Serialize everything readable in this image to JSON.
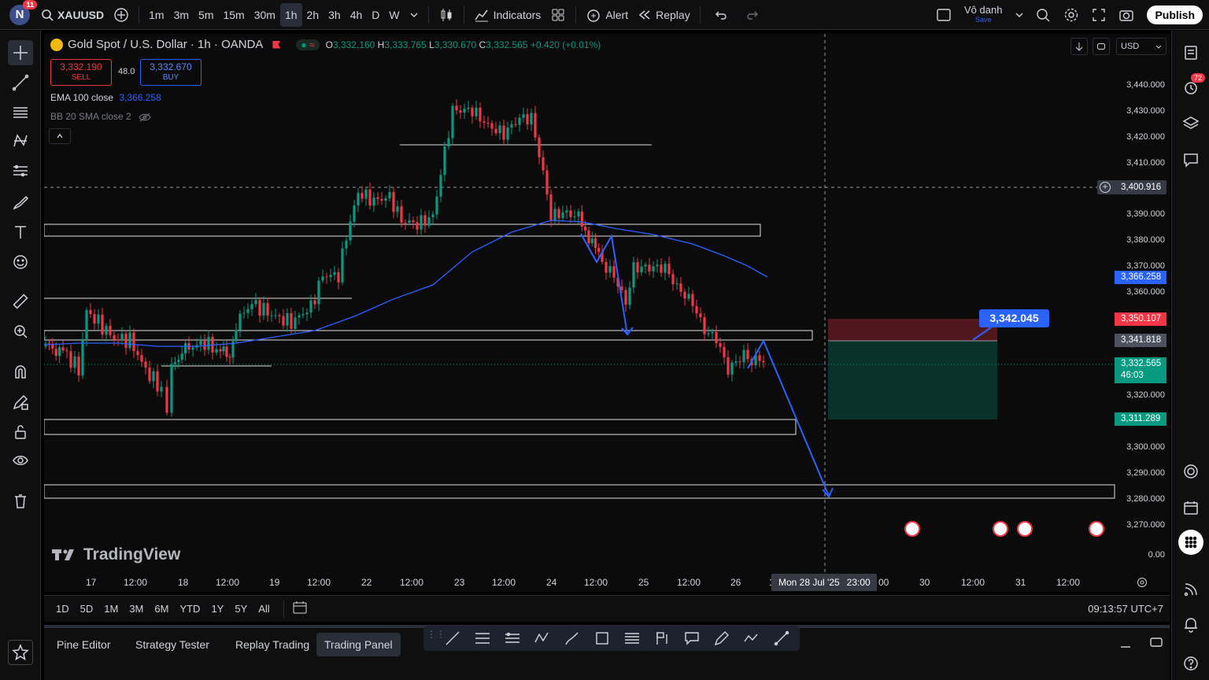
{
  "topbar": {
    "avatar_letter": "N",
    "avatar_badge": "11",
    "symbol": "XAUUSD",
    "intervals": [
      "1m",
      "3m",
      "5m",
      "15m",
      "30m",
      "1h",
      "2h",
      "3h",
      "4h",
      "D",
      "W"
    ],
    "active_interval": "1h",
    "indicators_label": "Indicators",
    "alert_label": "Alert",
    "replay_label": "Replay",
    "layout_name": "Vô danh",
    "layout_save": "Save",
    "publish_label": "Publish"
  },
  "legend": {
    "title": "Gold Spot / U.S. Dollar · 1h · OANDA",
    "o": "3,332.160",
    "h": "3,333.765",
    "l": "3,330.670",
    "c": "3,332.565",
    "change": "+0.420 (+0.01%)",
    "sell_price": "3,332.190",
    "sell_label": "SELL",
    "spread": "48.0",
    "buy_price": "3,332.670",
    "buy_label": "BUY",
    "ema_label": "EMA 100 close",
    "ema_value": "3,366.258",
    "bb_label": "BB 20 SMA close 2"
  },
  "price_axis": {
    "currency": "USD",
    "labels": [
      "3,430.000",
      "3,440.000",
      "3,430.000",
      "3,420.000",
      "3,410.000",
      "3,400.000",
      "3,390.000",
      "3,380.000",
      "3,370.000",
      "3,360.000",
      "3,350.000",
      "3,340.000",
      "3,330.000",
      "3,320.000",
      "3,310.000",
      "3,300.000",
      "3,290.000",
      "3,280.000",
      "3,270.000",
      "0.00"
    ],
    "crosshair_price": "3,400.916",
    "ema_tag": "3,366.258",
    "stop_tag": "3,350.107",
    "entry_tag": "3,341.818",
    "last_price": "3,332.565",
    "countdown": "46:03",
    "target_tag": "3,311.289",
    "position_label": "3,342.045"
  },
  "time_axis": {
    "labels": [
      "17",
      "12:00",
      "18",
      "12:00",
      "19",
      "12:00",
      "22",
      "12:00",
      "23",
      "12:00",
      "24",
      "12:00",
      "25",
      "12:00",
      "26",
      "1",
      "00",
      "30",
      "12:00",
      "31",
      "12:00"
    ],
    "crosshair_time": "Mon 28 Jul '25",
    "crosshair_hour": "23:00"
  },
  "bottombar": {
    "ranges": [
      "1D",
      "5D",
      "1M",
      "3M",
      "6M",
      "YTD",
      "1Y",
      "5Y",
      "All"
    ],
    "clock": "09:13:57 UTC+7"
  },
  "panel": {
    "tabs": [
      "Pine Editor",
      "Strategy Tester",
      "Replay Trading",
      "Trading Panel"
    ],
    "active_tab": "Trading Panel"
  },
  "rightbar": {
    "alerts_badge": "72"
  },
  "watermark": "TradingView",
  "colors": {
    "up": "#089981",
    "down": "#f23645",
    "ema": "#2962ff",
    "accent": "#2962ff"
  }
}
